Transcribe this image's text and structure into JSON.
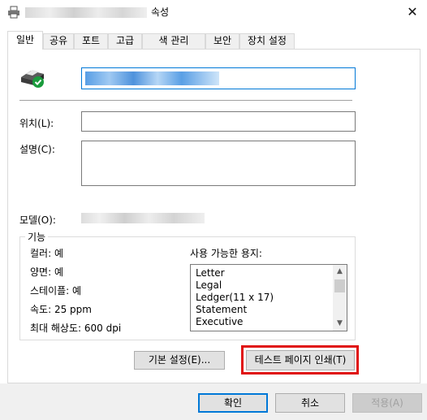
{
  "window": {
    "title_suffix": "속성",
    "close_glyph": "✕"
  },
  "tabs": [
    {
      "label": "일반",
      "active": true
    },
    {
      "label": "공유"
    },
    {
      "label": "포트"
    },
    {
      "label": "고급"
    },
    {
      "label": "색 관리"
    },
    {
      "label": "보안"
    },
    {
      "label": "장치 설정"
    }
  ],
  "general": {
    "printer_name_value": "",
    "location_label": "위치(L):",
    "location_value": "",
    "comment_label": "설명(C):",
    "comment_value": "",
    "model_label": "모델(O):"
  },
  "features": {
    "group_title": "기능",
    "color": "컬러: 예",
    "duplex": "양면: 예",
    "staple": "스테이플: 예",
    "speed": "속도: 25 ppm",
    "max_resolution": "최대 해상도: 600 dpi",
    "paper_label": "사용 가능한 용지:",
    "paper_sizes": [
      "Letter",
      "Legal",
      "Ledger(11 x 17)",
      "Statement",
      "Executive"
    ]
  },
  "buttons": {
    "preferences": "기본 설정(E)...",
    "print_test_page": "테스트 페이지 인쇄(T)",
    "ok": "확인",
    "cancel": "취소",
    "apply": "적용(A)"
  },
  "icons": {
    "title": "printer-icon",
    "status": "printer-ready-icon"
  },
  "colors": {
    "highlight": "#e01010",
    "accent": "#0078d7",
    "ready_check": "#1a9b3c"
  }
}
